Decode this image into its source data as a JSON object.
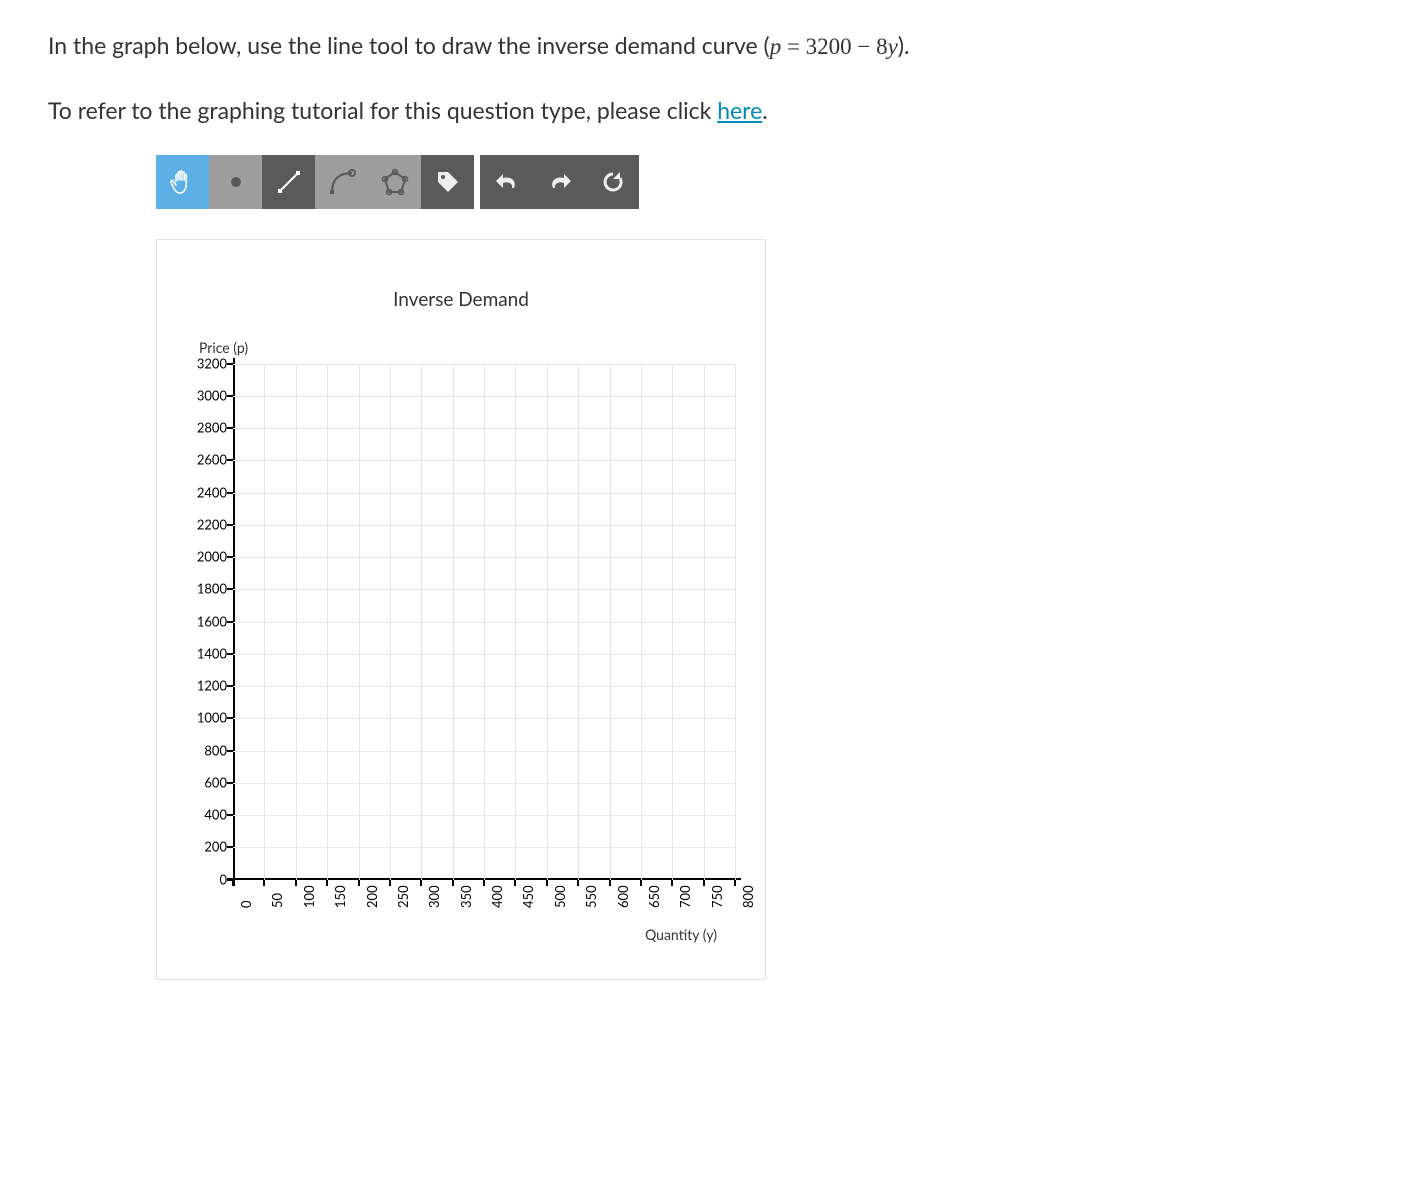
{
  "prompt": {
    "prefix": "In the graph below, use the line tool to draw the inverse demand curve (",
    "eq_var": "p",
    "eq_equals": " = ",
    "eq_const": "3200",
    "eq_minus": " − ",
    "eq_coeff": "8",
    "eq_y": "y",
    "suffix": ")."
  },
  "tutorial": {
    "prefix": "To refer to the graphing tutorial for this question type, please click ",
    "link": "here",
    "suffix": "."
  },
  "toolbar": {
    "tools": [
      {
        "id": "pan",
        "selected": true
      },
      {
        "id": "point",
        "selected": false
      },
      {
        "id": "line",
        "selected": false
      },
      {
        "id": "curve",
        "selected": false
      },
      {
        "id": "polygon",
        "selected": false
      },
      {
        "id": "label",
        "selected": false
      }
    ],
    "actions": [
      {
        "id": "undo"
      },
      {
        "id": "redo"
      },
      {
        "id": "reset"
      }
    ]
  },
  "chart_data": {
    "type": "line",
    "title": "Inverse Demand",
    "ylabel": "Price (p)",
    "xlabel": "Quantity (y)",
    "x_ticks": [
      0,
      50,
      100,
      150,
      200,
      250,
      300,
      350,
      400,
      450,
      500,
      550,
      600,
      650,
      700,
      750,
      800
    ],
    "y_ticks": [
      0,
      200,
      400,
      600,
      800,
      1000,
      1200,
      1400,
      1600,
      1800,
      2000,
      2200,
      2400,
      2600,
      2800,
      3000,
      3200
    ],
    "x_range": [
      0,
      800
    ],
    "y_range": [
      0,
      3200
    ],
    "series": [],
    "equation": "p = 3200 - 8y"
  }
}
